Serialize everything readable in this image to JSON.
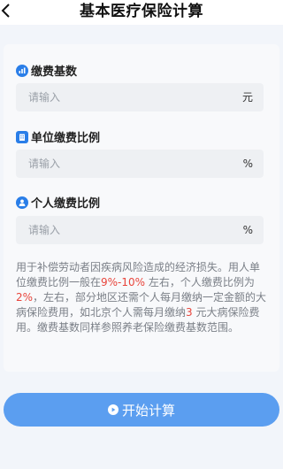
{
  "header": {
    "back_icon": "chevron-left-icon",
    "title": "基本医疗保险计算"
  },
  "form": {
    "base": {
      "icon": "bar-chart-icon",
      "label": "缴费基数",
      "placeholder": "请输入",
      "unit": "元"
    },
    "employer_rate": {
      "icon": "building-icon",
      "label": "单位缴费比例",
      "placeholder": "请输入",
      "unit": "%"
    },
    "personal_rate": {
      "icon": "person-icon",
      "label": "个人缴费比例",
      "placeholder": "请输入",
      "unit": "%"
    }
  },
  "description": {
    "part1": "用于补偿劳动者因疾病风险造成的经济损失。用人单位缴费比例一般在",
    "hl1": "9%-10%",
    "part2": " 左右，个人缴费比例为 ",
    "hl2": "2%",
    "part3": "，左右，部分地区还需个人每月缴纳一定金额的大病保险费用，如北京个人需每月缴纳",
    "hl3": "3",
    "part4": " 元大病保险费用。缴费基数同样参照养老保险缴费基数范围。"
  },
  "action": {
    "icon": "play-circle-icon",
    "label": "开始计算"
  },
  "colors": {
    "accent": "#2a7ee8",
    "button": "#5b9ef0",
    "highlight": "#e8453c",
    "background": "#f2f5fa"
  }
}
